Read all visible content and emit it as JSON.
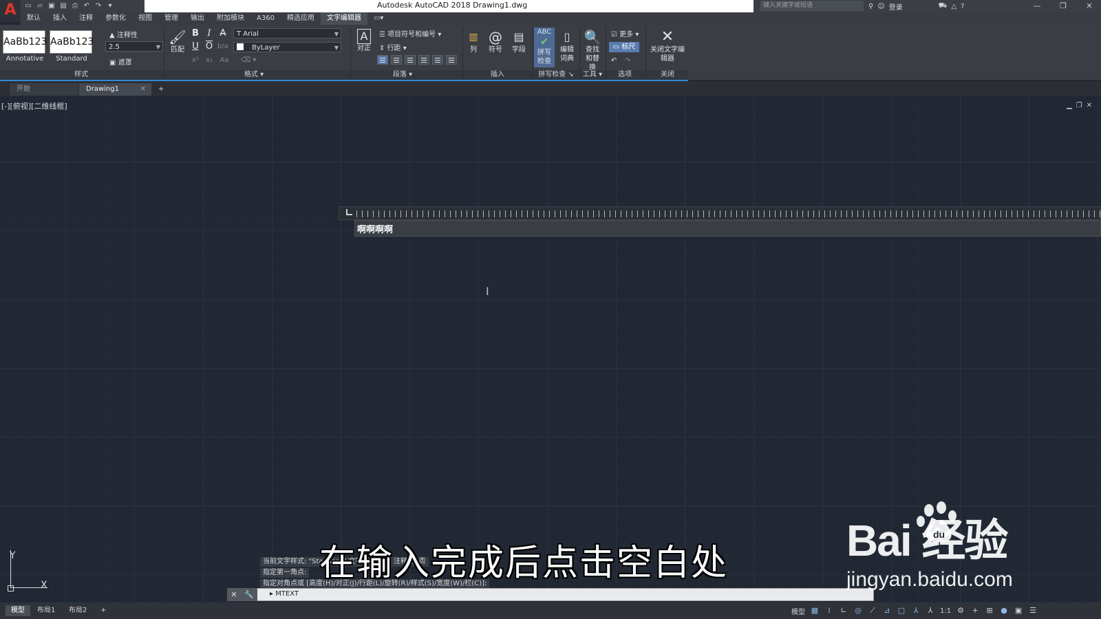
{
  "app": {
    "title": "Autodesk AutoCAD 2018    Drawing1.dwg",
    "logo_letter": "A",
    "search_placeholder": "键入关键字或短语",
    "login_label": "登录"
  },
  "window_controls": [
    "—",
    "❐",
    "✕"
  ],
  "menu_tabs": [
    "默认",
    "插入",
    "注释",
    "参数化",
    "视图",
    "管理",
    "输出",
    "附加模块",
    "A360",
    "精选应用",
    "文字编辑器"
  ],
  "ribbon": {
    "styles": {
      "style1_preview": "AaBb123",
      "style1_name": "Annotative",
      "style2_preview": "AaBb123",
      "style2_name": "Standard",
      "annotative_label": "注释性",
      "text_height": "2.5",
      "mask_label": "遮罩",
      "panel_title": "样式"
    },
    "format": {
      "match_label": "匹配",
      "font": "Arial",
      "color": "ByLayer",
      "panel_title": "格式"
    },
    "paragraph": {
      "justify_label": "对正",
      "bullets_label": "项目符号和编号",
      "line_spacing_label": "行距",
      "panel_title": "段落"
    },
    "insert": {
      "columns_label": "列",
      "symbol_label": "符号",
      "field_label": "字段",
      "panel_title": "插入"
    },
    "spell": {
      "spell_label": "拼写检查",
      "dict_label": "编辑词典",
      "panel_title": "拼写检查"
    },
    "tools": {
      "find_label": "查找和替换",
      "panel_title": "工具"
    },
    "options": {
      "more_label": "更多",
      "ruler_label": "标尺",
      "panel_title": "选项"
    },
    "close": {
      "close_label": "关闭文字编辑器",
      "panel_title": "关闭"
    }
  },
  "doc_tabs": [
    "开始",
    "Drawing1"
  ],
  "viewport": {
    "label": "[-][俯视][二维线框]"
  },
  "mtext": {
    "content": "啊啊啊啊"
  },
  "ucs": {
    "x": "X",
    "y": "Y"
  },
  "command": {
    "history": [
      "当前文字样式: \"Standard\"  文字高度: 2.5  注释性: 否",
      "指定第一角点:",
      "指定对角点或 [高度(H)/对正(J)/行距(L)/旋转(R)/样式(S)/宽度(W)/栏(C)]:"
    ],
    "input": "MTEXT"
  },
  "caption": "在输入完成后点击空白处",
  "watermark": {
    "brand": "Bai  经验",
    "url": "jingyan.baidu.com"
  },
  "layout_tabs": [
    "模型",
    "布局1",
    "布局2"
  ],
  "status": {
    "model_label": "模型",
    "scale": "1:1"
  }
}
